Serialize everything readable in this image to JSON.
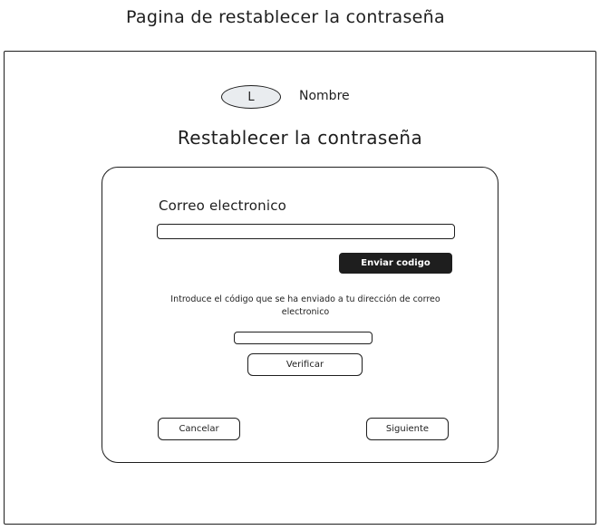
{
  "page_heading": "Pagina de restablecer la contraseña",
  "header": {
    "logo_letter": "L",
    "app_name": "Nombre"
  },
  "form": {
    "title": "Restablecer la contraseña",
    "email_label": "Correo electronico",
    "email_value": "",
    "send_code_label": "Enviar codigo",
    "instructions": "Introduce el código que se ha enviado a tu dirección de correo electronico",
    "code_value": "",
    "verify_label": "Verificar",
    "cancel_label": "Cancelar",
    "next_label": "Siguiente"
  }
}
